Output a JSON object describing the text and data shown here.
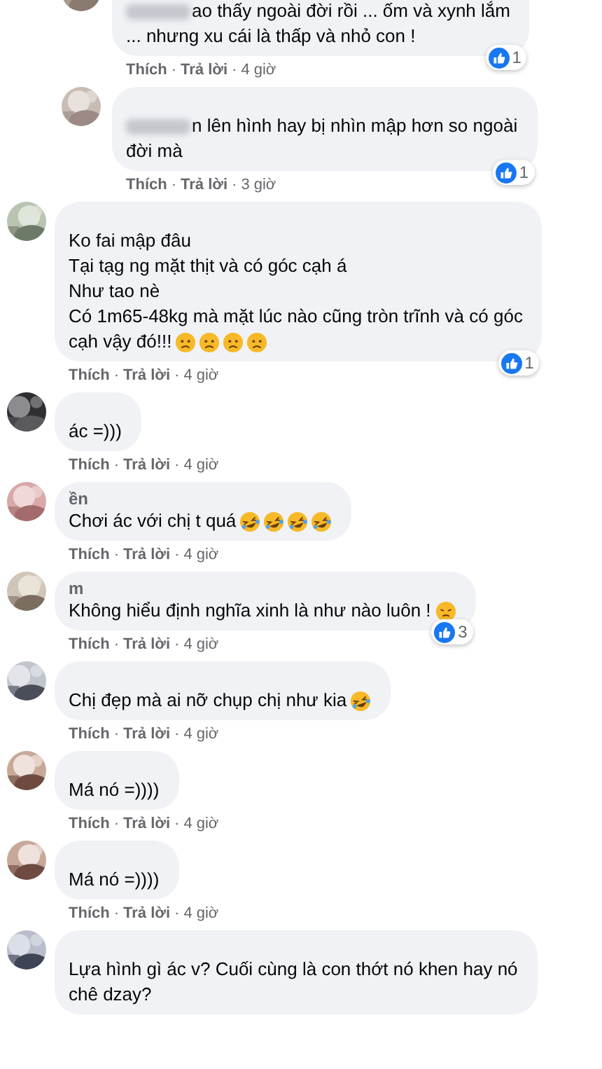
{
  "comments": [
    {
      "reply": true,
      "text_blurred_prefix": true,
      "lines": [
        "ao thấy ngoài đời rồi ... ốm và xynh lắm",
        "... nhưng xu cái là thấp và nhỏ con !"
      ],
      "likes": "1",
      "meta": [
        {
          "kind": "link",
          "text": "Thích"
        },
        {
          "kind": "dot",
          "text": "·"
        },
        {
          "kind": "link",
          "text": "Trả lời"
        },
        {
          "kind": "dot",
          "text": "·"
        },
        {
          "kind": "time",
          "text": "4 giờ"
        }
      ]
    },
    {
      "reply": true,
      "text_blurred_prefix": true,
      "lines": [
        "n lên hình hay bị nhìn mập hơn so ngoài",
        "đời mà"
      ],
      "likes": "1",
      "meta": [
        {
          "kind": "link",
          "text": "Thích"
        },
        {
          "kind": "dot",
          "text": "·"
        },
        {
          "kind": "link",
          "text": "Trả lời"
        },
        {
          "kind": "dot",
          "text": "·"
        },
        {
          "kind": "time",
          "text": "3 giờ"
        }
      ]
    },
    {
      "reply": false,
      "lines": [
        "Ko fai mập đâu",
        "Tại tạg ng mặt thịt và có góc cạh á",
        "Như tao nè",
        "Có 1m65-48kg mà mặt lúc nào cũng tròn trĩnh và có góc",
        "cạh vậy đó!!!"
      ],
      "emojis": [
        {
          "kind": "worried"
        },
        {
          "kind": "worried"
        },
        {
          "kind": "worried"
        },
        {
          "kind": "worried"
        }
      ],
      "likes": "1",
      "meta": [
        {
          "kind": "link",
          "text": "Thích"
        },
        {
          "kind": "dot",
          "text": "·"
        },
        {
          "kind": "link",
          "text": "Trả lời"
        },
        {
          "kind": "dot",
          "text": "·"
        },
        {
          "kind": "time",
          "text": "4 giờ"
        }
      ]
    },
    {
      "reply": false,
      "lines": [
        "ác =)))"
      ],
      "meta": [
        {
          "kind": "link",
          "text": "Thích"
        },
        {
          "kind": "dot",
          "text": "·"
        },
        {
          "kind": "link",
          "text": "Trả lời"
        },
        {
          "kind": "dot",
          "text": "·"
        },
        {
          "kind": "time",
          "text": "4 giờ"
        }
      ]
    },
    {
      "reply": false,
      "name_visible": "ền",
      "lines": [
        "Chơi ác với chị t quá"
      ],
      "emojis": [
        {
          "kind": "rofl"
        },
        {
          "kind": "rofl"
        },
        {
          "kind": "rofl"
        },
        {
          "kind": "rofl"
        }
      ],
      "meta": [
        {
          "kind": "link",
          "text": "Thích"
        },
        {
          "kind": "dot",
          "text": "·"
        },
        {
          "kind": "link",
          "text": "Trả lời"
        },
        {
          "kind": "dot",
          "text": "·"
        },
        {
          "kind": "time",
          "text": "4 giờ"
        }
      ]
    },
    {
      "reply": false,
      "name_visible": "m",
      "lines": [
        "Không hiểu định nghĩa xinh là như nào luôn !"
      ],
      "emojis": [
        {
          "kind": "persevere"
        }
      ],
      "likes": "3",
      "meta": [
        {
          "kind": "link",
          "text": "Thích"
        },
        {
          "kind": "dot",
          "text": "·"
        },
        {
          "kind": "link",
          "text": "Trả lời"
        },
        {
          "kind": "dot",
          "text": "·"
        },
        {
          "kind": "time",
          "text": "4 giờ"
        }
      ]
    },
    {
      "reply": false,
      "lines": [
        "Chị đẹp mà ai nỡ chụp chị như kia"
      ],
      "emojis": [
        {
          "kind": "rofl"
        }
      ],
      "meta": [
        {
          "kind": "link",
          "text": "Thích"
        },
        {
          "kind": "dot",
          "text": "·"
        },
        {
          "kind": "link",
          "text": "Trả lời"
        },
        {
          "kind": "dot",
          "text": "·"
        },
        {
          "kind": "time",
          "text": "4 giờ"
        }
      ]
    },
    {
      "reply": false,
      "lines": [
        "Má nó =))))"
      ],
      "meta": [
        {
          "kind": "link",
          "text": "Thích"
        },
        {
          "kind": "dot",
          "text": "·"
        },
        {
          "kind": "link",
          "text": "Trả lời"
        },
        {
          "kind": "dot",
          "text": "·"
        },
        {
          "kind": "time",
          "text": "4 giờ"
        }
      ]
    },
    {
      "reply": false,
      "lines": [
        "Má nó =))))"
      ],
      "meta": [
        {
          "kind": "link",
          "text": "Thích"
        },
        {
          "kind": "dot",
          "text": "·"
        },
        {
          "kind": "link",
          "text": "Trả lời"
        },
        {
          "kind": "dot",
          "text": "·"
        },
        {
          "kind": "time",
          "text": "4 giờ"
        }
      ]
    },
    {
      "reply": false,
      "lines": [
        "Lựa hình gì ác v? Cuối cùng là con thớt nó khen hay nó",
        "chê dzay?"
      ]
    }
  ]
}
